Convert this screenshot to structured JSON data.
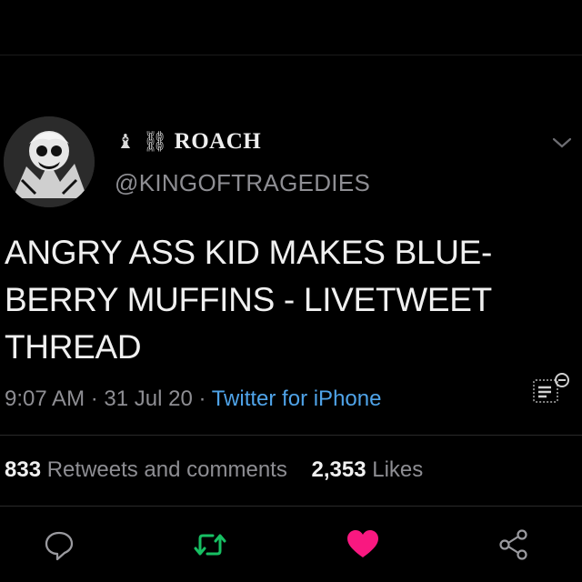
{
  "tweet": {
    "author": {
      "name_glyphs": "♝ ⛓",
      "display_name": "ROACH",
      "handle": "@KINGOFTRAGEDIES"
    },
    "text_lines": [
      "ANGRY ASS KID MAKES BLUE-",
      "BERRY MUFFINS - LIVETWEET",
      "THREAD"
    ],
    "time": "9:07 AM",
    "date": "31 Jul 20",
    "separator": " · ",
    "source": "Twitter for iPhone",
    "retweets_count": "833",
    "retweets_label": "Retweets and comments",
    "likes_count": "2,353",
    "likes_label": "Likes"
  },
  "actions": [
    {
      "icon": "reply-icon"
    },
    {
      "icon": "retweet-icon",
      "color": "#17bf63"
    },
    {
      "icon": "like-icon",
      "color": "#f91880"
    },
    {
      "icon": "share-icon"
    }
  ],
  "colors": {
    "background": "#000000",
    "link": "#4fa3e8",
    "retweet_active": "#17bf63",
    "like_active": "#f91880",
    "muted_text": "#8e8e93"
  }
}
